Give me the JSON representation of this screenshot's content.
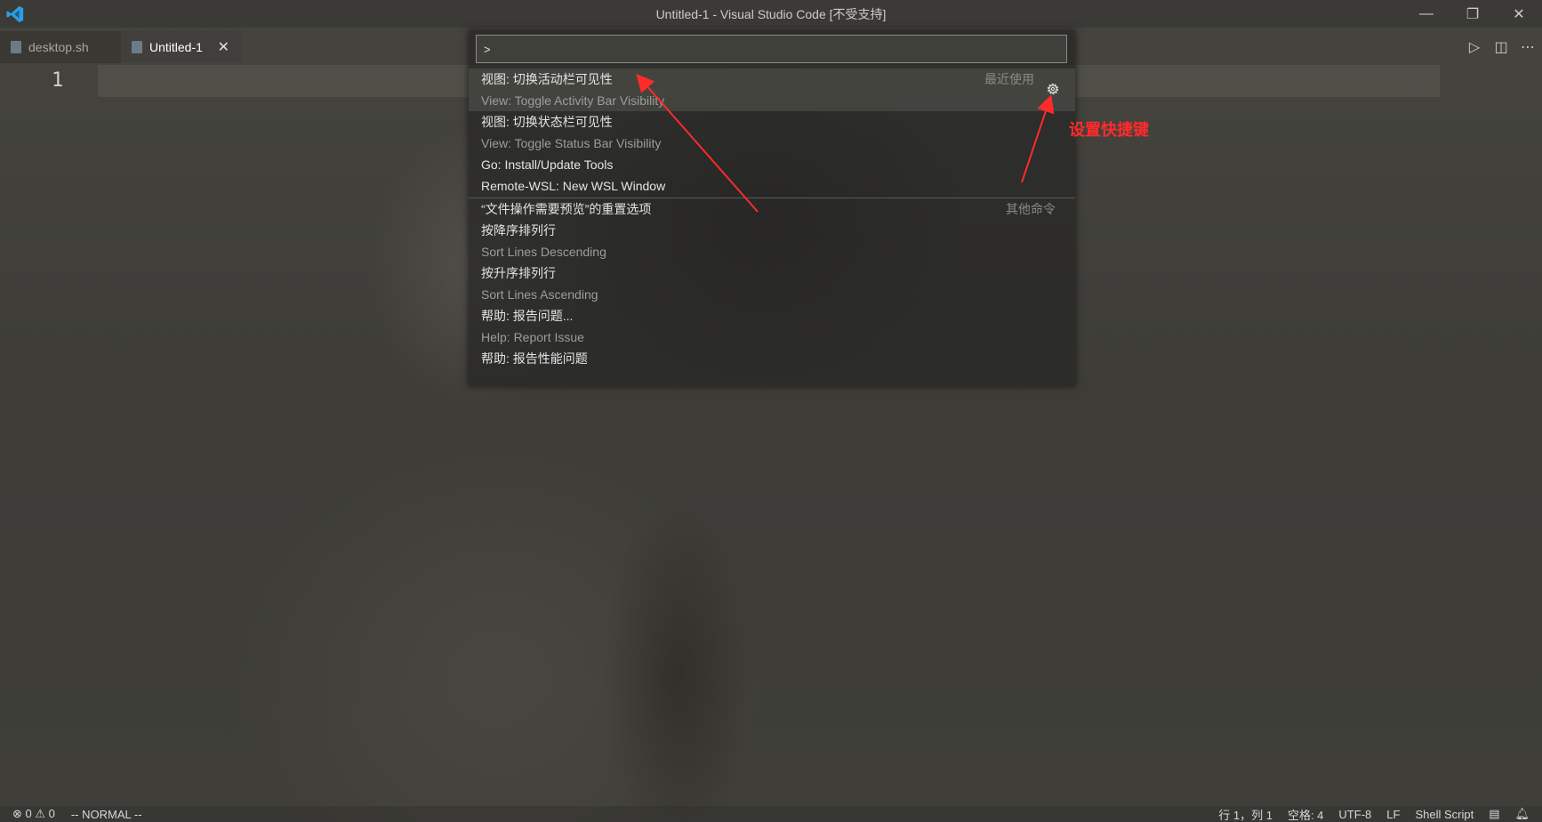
{
  "window": {
    "title": "Untitled-1 - Visual Studio Code [不受支持]",
    "controls": {
      "minimize": "—",
      "restore": "❐",
      "close": "✕"
    }
  },
  "tabs": [
    {
      "label": "desktop.sh",
      "active": false
    },
    {
      "label": "Untitled-1",
      "active": true,
      "close": "✕"
    }
  ],
  "editor": {
    "line_number": "1"
  },
  "editor_actions": {
    "run": "▷",
    "split": "◫",
    "more": "⋯"
  },
  "command_palette": {
    "input_value": ">",
    "items": [
      {
        "main": "视图: 切换活动栏可见性",
        "sub": "View: Toggle Activity Bar Visibility",
        "tag": "最近使用",
        "selected": true
      },
      {
        "main": "视图: 切换状态栏可见性",
        "sub": "View: Toggle Status Bar Visibility"
      },
      {
        "main": "Go: Install/Update Tools"
      },
      {
        "main": "Remote-WSL: New WSL Window"
      },
      {
        "main": "“文件操作需要预览”的重置选项",
        "tag": "其他命令"
      },
      {
        "main": "按降序排列行",
        "sub": "Sort Lines Descending"
      },
      {
        "main": "按升序排列行",
        "sub": "Sort Lines Ascending"
      },
      {
        "main": "帮助: 报告问题...",
        "sub": "Help: Report Issue"
      },
      {
        "main": "帮助: 报告性能问题"
      }
    ]
  },
  "annotation": {
    "text": "设置快捷键",
    "color": "#ff2b2b"
  },
  "status_bar": {
    "errors": "⊗ 0 ⚠ 0",
    "mode": "-- NORMAL --",
    "position": "行 1，列 1",
    "spaces": "空格: 4",
    "encoding": "UTF-8",
    "eol": "LF",
    "language": "Shell Script"
  }
}
